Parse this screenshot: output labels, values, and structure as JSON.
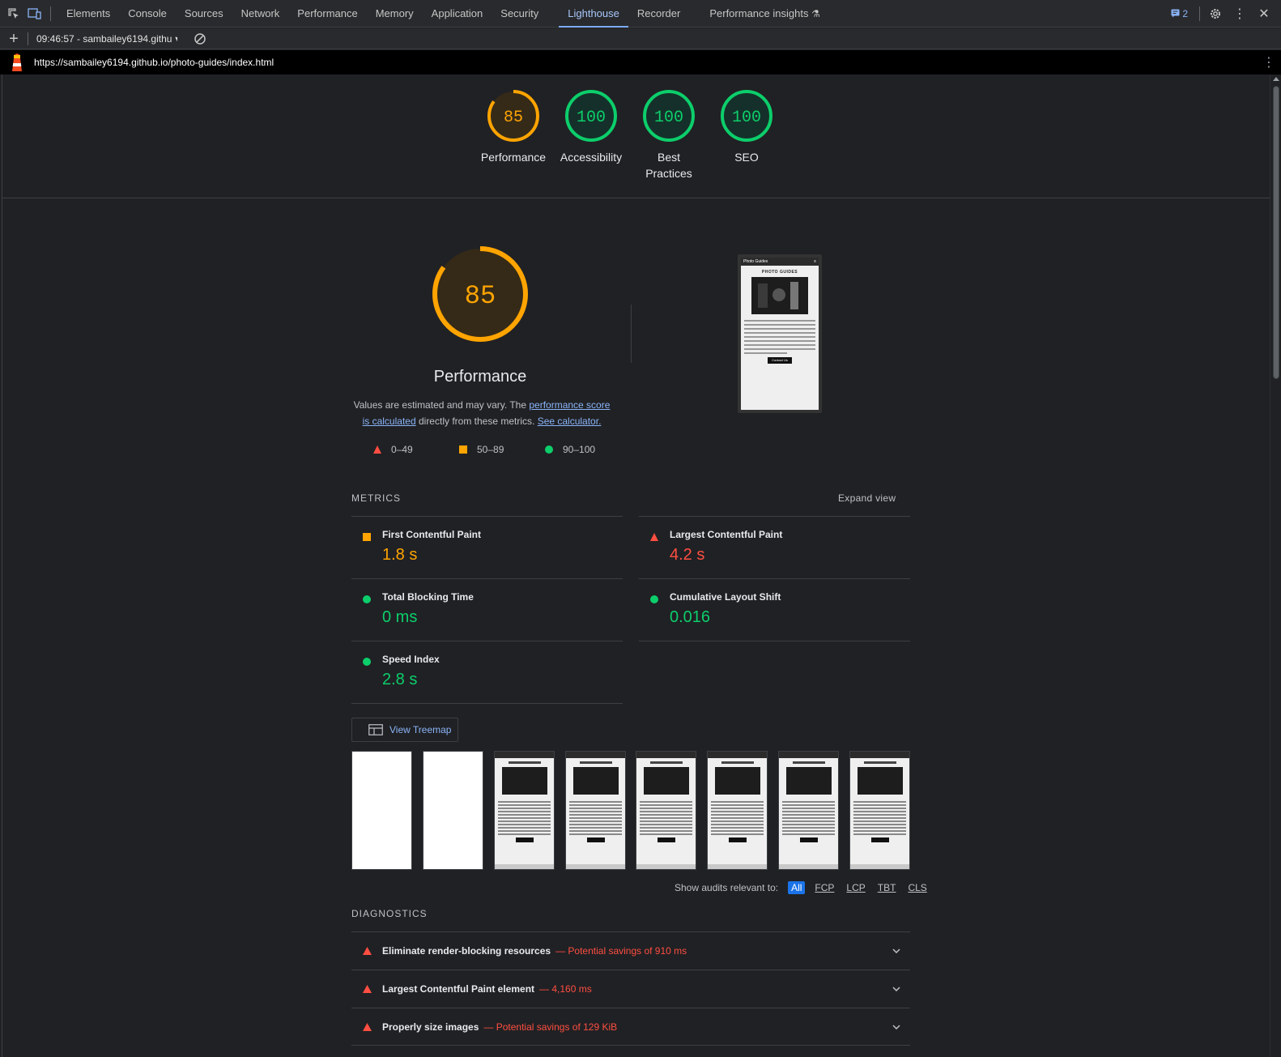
{
  "devtools": {
    "tabs": [
      "Elements",
      "Console",
      "Sources",
      "Network",
      "Performance",
      "Memory",
      "Application",
      "Security",
      "Lighthouse",
      "Recorder",
      "Performance insights"
    ],
    "active_tab": "Lighthouse",
    "issues_count": "2"
  },
  "toolbar": {
    "report_label": "09:46:57 - sambailey6194.githu"
  },
  "urlbar": {
    "url": "https://sambailey6194.github.io/photo-guides/index.html"
  },
  "summary": [
    {
      "label": "Performance",
      "score": "85",
      "color": "#ffa400"
    },
    {
      "label": "Accessibility",
      "score": "100",
      "color": "#0cce6b"
    },
    {
      "label": "Best\nPractices",
      "score": "100",
      "color": "#0cce6b"
    },
    {
      "label": "SEO",
      "score": "100",
      "color": "#0cce6b"
    }
  ],
  "performance": {
    "score": "85",
    "title": "Performance",
    "desc_prefix": "Values are estimated and may vary. The ",
    "desc_link1": "performance score is calculated",
    "desc_middle": " directly from these metrics. ",
    "desc_link2": "See calculator.",
    "legend": [
      "0–49",
      "50–89",
      "90–100"
    ]
  },
  "screenshot": {
    "site_title": "Photo Guides",
    "heading": "PHOTO GUIDES",
    "button": "Contact Us"
  },
  "metrics": {
    "title": "Metrics",
    "expand": "Expand view",
    "fcp": {
      "label": "First Contentful Paint",
      "value": "1.8 s"
    },
    "lcp": {
      "label": "Largest Contentful Paint",
      "value": "4.2 s"
    },
    "tbt": {
      "label": "Total Blocking Time",
      "value": "0 ms"
    },
    "cls": {
      "label": "Cumulative Layout Shift",
      "value": "0.016"
    },
    "si": {
      "label": "Speed Index",
      "value": "2.8 s"
    }
  },
  "treemap_label": "View Treemap",
  "filter": {
    "label": "Show audits relevant to:",
    "chips": [
      "All",
      "FCP",
      "LCP",
      "TBT",
      "CLS"
    ]
  },
  "diagnostics": {
    "title": "Diagnostics",
    "items": [
      {
        "title": "Eliminate render-blocking resources",
        "detail": "— Potential savings of 910 ms"
      },
      {
        "title": "Largest Contentful Paint element",
        "detail": "— 4,160 ms"
      },
      {
        "title": "Properly size images",
        "detail": "— Potential savings of 129 KiB"
      }
    ]
  },
  "colors": {
    "fail": "#ff4e42",
    "average": "#ffa400",
    "pass": "#0cce6b",
    "link": "#8ab4f8"
  }
}
